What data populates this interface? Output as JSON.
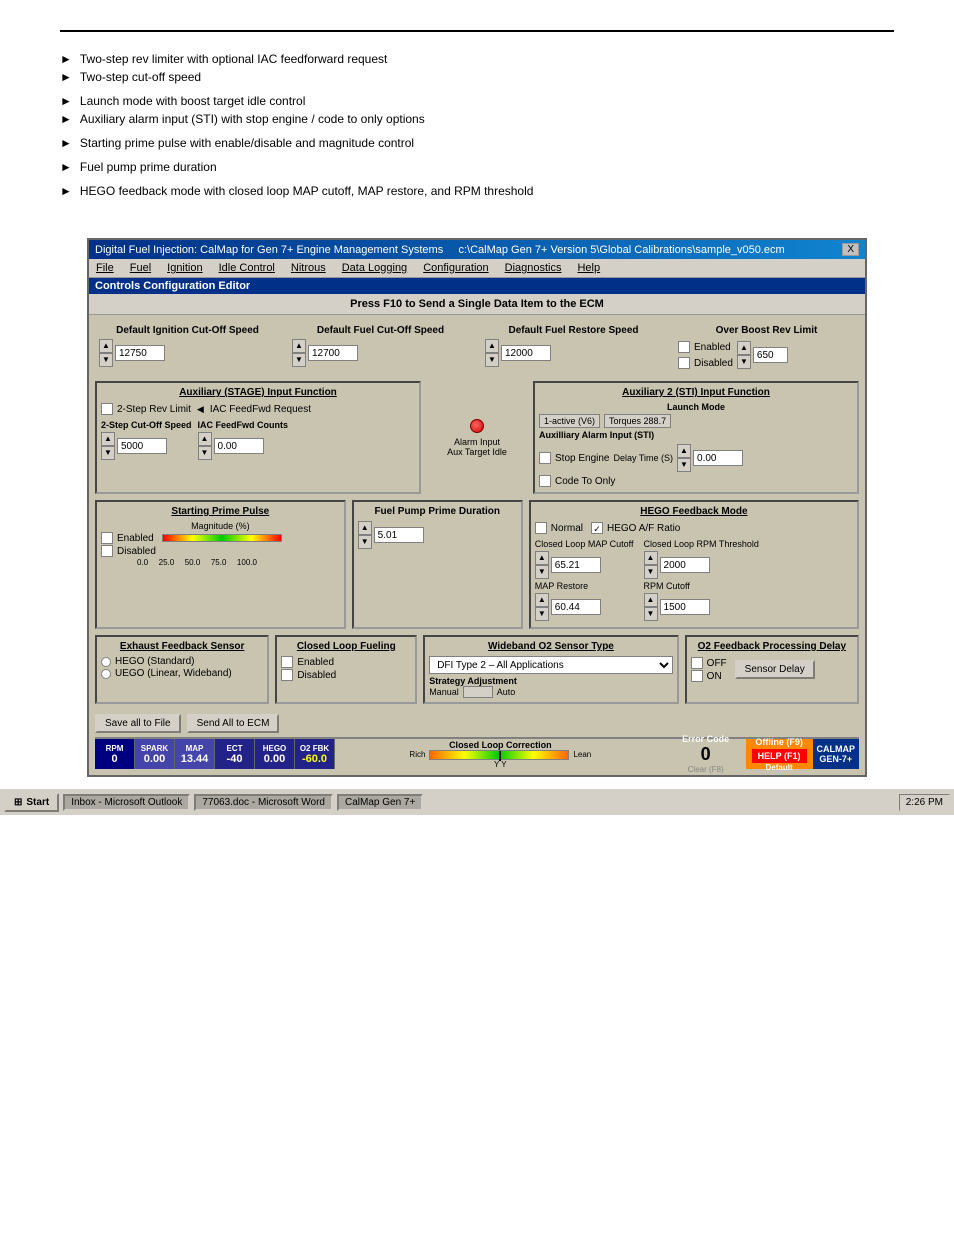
{
  "document": {
    "bullets_group1": [
      "Two-step rev limiter with optional IAC feedforward request",
      "Two-step cut-off speed"
    ],
    "bullets_group2": [
      "Launch mode with boost target idle control",
      "Auxiliary alarm input (STI) with stop engine / code to only options"
    ],
    "bullets_group3": [
      "Starting prime pulse with enable/disable and magnitude control"
    ],
    "bullets_group4": [
      "Fuel pump prime duration"
    ],
    "bullets_group5": [
      "HEGO feedback mode with closed loop MAP cutoff, MAP restore, and RPM threshold"
    ]
  },
  "app": {
    "title": "Digital Fuel Injection: CalMap for Gen 7+ Engine Management Systems",
    "filepath": "c:\\CalMap Gen 7+ Version 5\\Global Calibrations\\sample_v050.ecm",
    "close_btn": "X"
  },
  "menu": {
    "items": [
      "File",
      "Fuel",
      "Ignition",
      "Idle Control",
      "Nitrous",
      "Data Logging",
      "Configuration",
      "Diagnostics",
      "Help"
    ]
  },
  "editor": {
    "title": "Controls Configuration Editor",
    "press_f10": "Press F10 to Send a Single Data Item to the ECM"
  },
  "ignition_cutoff": {
    "label": "Default Ignition Cut-Off Speed",
    "value": "12750"
  },
  "fuel_cutoff": {
    "label": "Default Fuel Cut-Off Speed",
    "value": "12700"
  },
  "fuel_restore": {
    "label": "Default Fuel Restore Speed",
    "value": "12000"
  },
  "overboost": {
    "label": "Over Boost Rev Limit",
    "enabled_label": "Enabled",
    "disabled_label": "Disabled",
    "value": "650"
  },
  "aux_stage": {
    "title": "Auxiliary (STAGE) Input Function",
    "two_step_rev": "2-Step Rev Limit",
    "iac_feedfwd": "IAC FeedFwd Request",
    "two_step_cutoff": "2-Step Cut-Off Speed",
    "iac_counts": "IAC FeedFwd Counts",
    "cutoff_value": "5000",
    "counts_value": "0.00"
  },
  "aux_sti": {
    "title": "Auxiliary 2 (STI) Input Function",
    "launch_mode": "Launch Mode",
    "launch_value": "1-active (V6)",
    "target_value": "Torques 288.7",
    "alarm_input": "Alarm Input",
    "aux_target": "Aux Target Idle",
    "aux_alarm": "Auxilliary Alarm Input (STI)",
    "stop_engine": "Stop Engine",
    "code_to_only": "Code To Only",
    "delay_time": "Delay Time (S)",
    "delay_value": "0.00"
  },
  "prime_pulse": {
    "title": "Starting Prime Pulse",
    "magnitude_label": "Magnitude (%)",
    "enabled_label": "Enabled",
    "disabled_label": "Disabled",
    "scale_marks": [
      "0.0",
      "25.0",
      "50.0",
      "75.0",
      "100.0"
    ]
  },
  "fuel_pump": {
    "title": "Fuel Pump Prime Duration",
    "value": "5.01"
  },
  "hego": {
    "title": "HEGO Feedback Mode",
    "normal_label": "Normal",
    "hego_af_label": "HEGO A/F Ratio",
    "closed_loop_map": "Closed Loop MAP Cutoff",
    "map_value": "65.21",
    "map_restore": "MAP Restore",
    "map_restore_value": "60.44",
    "rpm_threshold": "Closed Loop RPM Threshold",
    "rpm_threshold_value": "2000",
    "rpm_cutoff": "RPM Cutoff",
    "rpm_cutoff_value": "1500"
  },
  "exhaust_feedback": {
    "title": "Exhaust Feedback Sensor",
    "hego_label": "HEGO (Standard)",
    "uego_label": "UEGO (Linear, Wideband)"
  },
  "closed_loop_fueling": {
    "title": "Closed Loop Fueling",
    "enabled_label": "Enabled",
    "disabled_label": "Disabled"
  },
  "wideband_o2": {
    "title": "Wideband O2 Sensor Type",
    "value": "DFI Type 2 – All Applications",
    "strategy": "Strategy Adjustment",
    "manual_label": "Manual",
    "auto_label": "Auto"
  },
  "o2_feedback": {
    "title": "O2 Feedback Processing Delay",
    "off_label": "OFF",
    "on_label": "ON",
    "sensor_delay": "Sensor Delay"
  },
  "toolbar": {
    "save_file": "Save all to File",
    "send_ecm": "Send All to ECM"
  },
  "statusbar": {
    "rpm_label": "RPM",
    "rpm_value": "0",
    "spark_label": "SPARK",
    "spark_value": "0.00",
    "map_label": "MAP",
    "map_value": "13.44",
    "ect_label": "ECT",
    "ect_value": "-40",
    "hego_label": "HEGO",
    "hego_value": "0.00",
    "o2fbk_label": "O2 FBK",
    "o2fbk_value": "-60.0",
    "closed_loop_title": "Closed Loop Correction",
    "cl_rich": "Rich",
    "cl_lean": "Lean",
    "cl_yy": "Y Y",
    "error_code_title": "Error Code",
    "error_code_value": "0",
    "offline_label": "Offline (F9)",
    "clear_f8": "Clear (F8)",
    "default_label": "Default",
    "help_label": "HELP (F1)",
    "calmap_label": "CALMAP\nGEN-7+"
  },
  "taskbar": {
    "start_label": "Start",
    "items": [
      "Inbox - Microsoft Outlook",
      "77063.doc - Microsoft Word",
      "CalMap Gen 7+"
    ],
    "time": "2:26 PM"
  }
}
